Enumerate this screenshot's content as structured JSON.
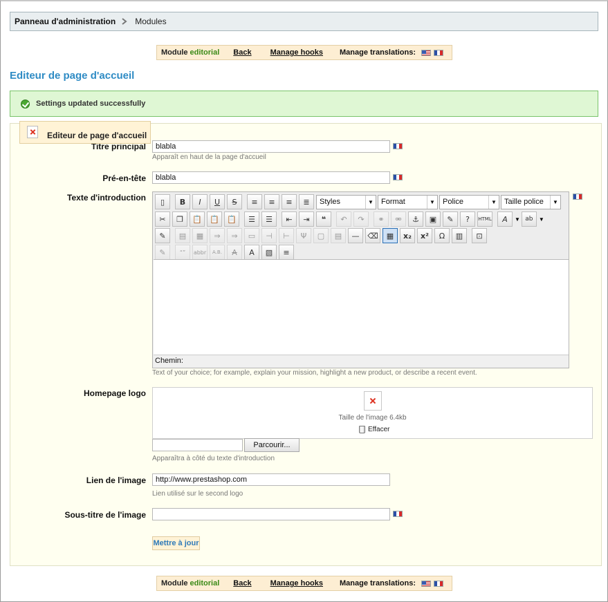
{
  "breadcrumb": {
    "root": "Panneau d'administration",
    "current": "Modules"
  },
  "toolbar": {
    "module_label": "Module",
    "module_name": "editorial",
    "back": "Back",
    "manage_hooks": "Manage hooks",
    "manage_translations": "Manage translations:"
  },
  "page_title": "Editeur de page d'accueil",
  "success": {
    "message": "Settings updated successfully"
  },
  "fieldset": {
    "legend": "Editeur de page d'accueil"
  },
  "fields": {
    "title": {
      "label": "Titre principal",
      "value": "blabla",
      "hint": "Apparaît en haut de la page d'accueil"
    },
    "header": {
      "label": "Pré-en-tête",
      "value": "blabla"
    },
    "intro": {
      "label": "Texte d'introduction",
      "hint": "Text of your choice; for example, explain your mission, highlight a new product, or describe a recent event.",
      "editor": {
        "styles": "Styles",
        "format": "Format",
        "font": "Police",
        "size": "Taille police",
        "status": "Chemin:"
      }
    },
    "logo": {
      "label": "Homepage logo",
      "size_text": "Taille de l'image 6.4kb",
      "delete": "Effacer",
      "browse": "Parcourir...",
      "hint": "Apparaîtra à côté du texte d'introduction"
    },
    "link": {
      "label": "Lien de l'image",
      "value": "http://www.prestashop.com",
      "hint": "Lien utilisé sur le second logo"
    },
    "subheading": {
      "label": "Sous-titre de l'image",
      "value": ""
    }
  },
  "submit": {
    "label": "Mettre à jour"
  },
  "colors": {
    "accent": "#2e8bc4",
    "success_bg": "#dff7d4",
    "module_name": "#3a8a17"
  }
}
